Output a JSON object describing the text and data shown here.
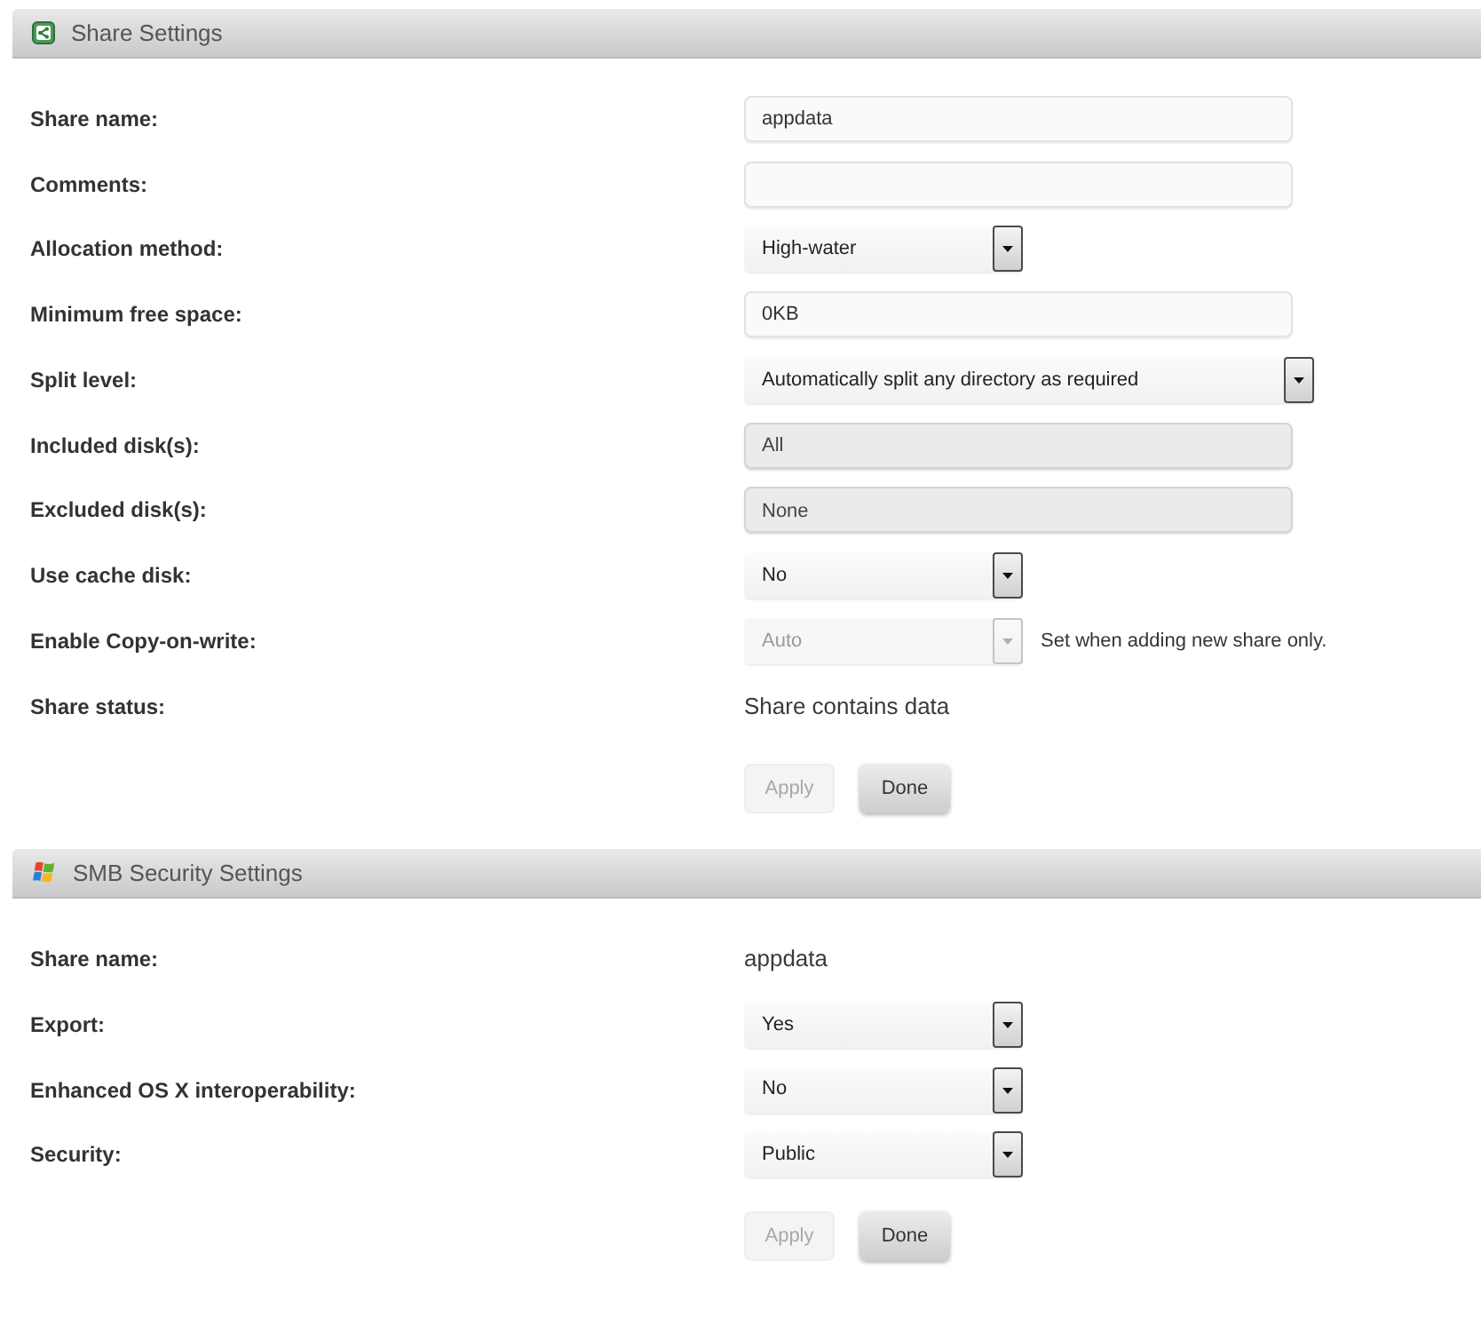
{
  "sections": [
    {
      "title": "Share Settings",
      "kind": "share",
      "fields": [
        {
          "label": "Share name:",
          "kind": "text",
          "value": "appdata"
        },
        {
          "label": "Comments:",
          "kind": "text"
        },
        {
          "label": "Allocation method:",
          "kind": "select",
          "value": "High-water",
          "disabled": false
        },
        {
          "label": "Minimum free space:",
          "kind": "text",
          "value": "0KB"
        },
        {
          "label": "Split level:",
          "kind": "select",
          "value": "Automatically split any directory as required",
          "disabled": false
        },
        {
          "label": "Included disk(s):",
          "kind": "disks",
          "value": "All"
        },
        {
          "label": "Excluded disk(s):",
          "kind": "disks",
          "value": "None"
        },
        {
          "label": "Use cache disk:",
          "kind": "select",
          "value": "No",
          "disabled": false
        },
        {
          "label": "Enable Copy-on-write:",
          "kind": "select",
          "value": "Auto",
          "disabled": true,
          "note": "Set when adding new share only."
        },
        {
          "label": "Share status:",
          "kind": "static",
          "value": "Share contains data"
        }
      ],
      "buttons": [
        {
          "label": "Apply",
          "disabled": true
        },
        {
          "label": "Done",
          "disabled": false
        }
      ]
    },
    {
      "title": "SMB Security Settings",
      "kind": "smb",
      "fields": [
        {
          "label": "Share name:",
          "kind": "static",
          "value": "appdata"
        },
        {
          "label": "Export:",
          "kind": "select",
          "value": "Yes",
          "disabled": false
        },
        {
          "label": "Enhanced OS X interoperability:",
          "kind": "select",
          "value": "No",
          "disabled": false
        },
        {
          "label": "Security:",
          "kind": "select",
          "value": "Public",
          "disabled": false
        }
      ],
      "buttons": [
        {
          "label": "Apply",
          "disabled": true
        },
        {
          "label": "Done",
          "disabled": false
        }
      ]
    }
  ]
}
